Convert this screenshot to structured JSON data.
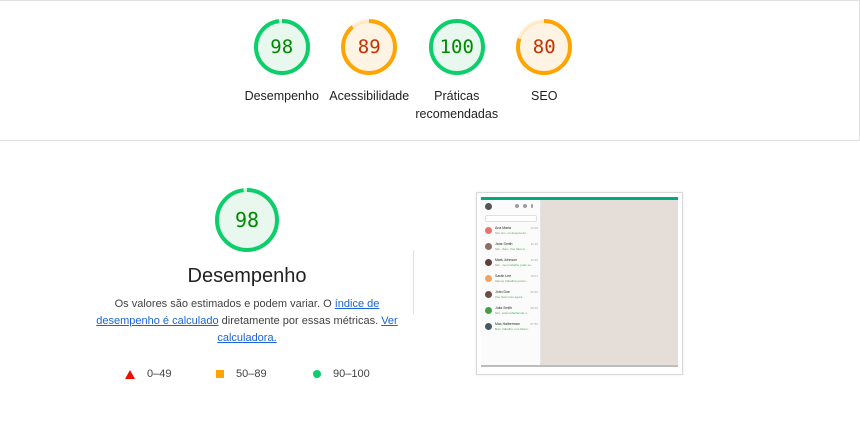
{
  "scores": [
    {
      "value": "98",
      "label": "Desempenho",
      "fraction": 0.98,
      "color": "#0cce6b",
      "fill": "#e8f8ee",
      "text_color": "#008800"
    },
    {
      "value": "89",
      "label": "Acessibilidade",
      "fraction": 0.89,
      "color": "#ffa400",
      "fill": "#fff3e3",
      "text_color": "#c33300"
    },
    {
      "value": "100",
      "label": "Práticas recomendadas",
      "fraction": 1.0,
      "color": "#0cce6b",
      "fill": "#e8f8ee",
      "text_color": "#008800"
    },
    {
      "value": "80",
      "label": "SEO",
      "fraction": 0.8,
      "color": "#ffa400",
      "fill": "#fff3e3",
      "text_color": "#c33300"
    }
  ],
  "performance": {
    "score": "98",
    "fraction": 0.98,
    "title": "Desempenho",
    "desc_part1": "Os valores são estimados e podem variar. O ",
    "link1": "índice de desempenho é calculado",
    "desc_part2": " diretamente por essas métricas. ",
    "link2": "Ver calculadora."
  },
  "legend": [
    {
      "icon": "red-triangle",
      "range": "0–49",
      "color": "#eb0f00"
    },
    {
      "icon": "orange-square",
      "range": "50–89",
      "color": "#ffa400"
    },
    {
      "icon": "green-circle",
      "range": "90–100",
      "color": "#0cce6b"
    }
  ],
  "screenshot": {
    "contacts": [
      {
        "name": "Ana Maria",
        "msg": "Sim sim, eu desenvolvi...",
        "time": "12:00",
        "avatar_color": "#e57373"
      },
      {
        "name": "Jane Smith",
        "msg": "Sim, claro. Vou falar pi...",
        "time": "11:10",
        "avatar_color": "#8d6e63"
      },
      {
        "name": "Mark Johnson",
        "msg": "Sim, meu trabalho pode se...",
        "time": "10:45",
        "avatar_color": "#5d4037"
      },
      {
        "name": "Sarah Lee",
        "msg": "Vamos trabalhar juntos...",
        "time": "10:01",
        "avatar_color": "#f4a261"
      },
      {
        "name": "John Doe",
        "msg": "Vou fazer isso agora...",
        "time": "09:30",
        "avatar_color": "#6d4c41"
      },
      {
        "name": "Julia Smith",
        "msg": "Sim, está trabalhando n...",
        "time": "08:15",
        "avatar_color": "#43a047"
      },
      {
        "name": "Max Halberman",
        "msg": "Bom trabalho, nos falam...",
        "time": "07:55",
        "avatar_color": "#455a64"
      }
    ]
  }
}
